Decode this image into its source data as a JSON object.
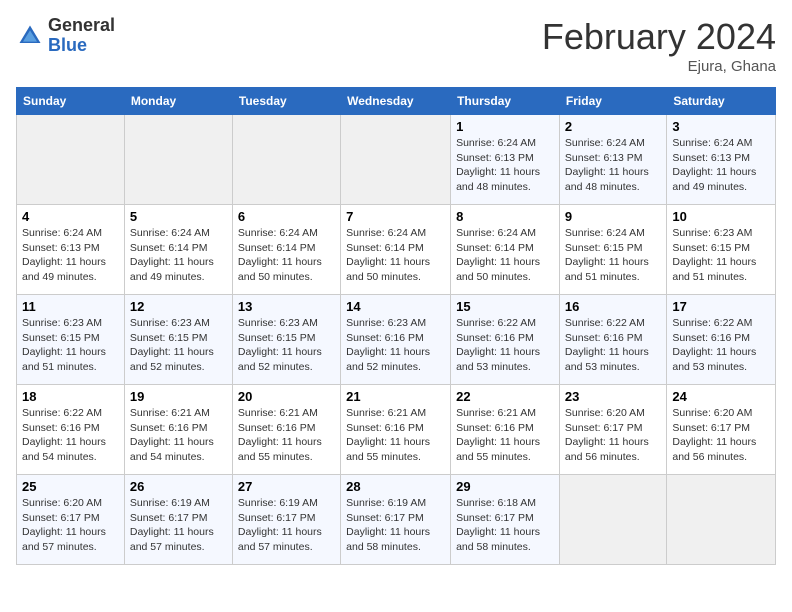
{
  "header": {
    "logo_general": "General",
    "logo_blue": "Blue",
    "month_title": "February 2024",
    "location": "Ejura, Ghana"
  },
  "days_of_week": [
    "Sunday",
    "Monday",
    "Tuesday",
    "Wednesday",
    "Thursday",
    "Friday",
    "Saturday"
  ],
  "weeks": [
    [
      {
        "day": "",
        "detail": ""
      },
      {
        "day": "",
        "detail": ""
      },
      {
        "day": "",
        "detail": ""
      },
      {
        "day": "",
        "detail": ""
      },
      {
        "day": "1",
        "detail": "Sunrise: 6:24 AM\nSunset: 6:13 PM\nDaylight: 11 hours and 48 minutes."
      },
      {
        "day": "2",
        "detail": "Sunrise: 6:24 AM\nSunset: 6:13 PM\nDaylight: 11 hours and 48 minutes."
      },
      {
        "day": "3",
        "detail": "Sunrise: 6:24 AM\nSunset: 6:13 PM\nDaylight: 11 hours and 49 minutes."
      }
    ],
    [
      {
        "day": "4",
        "detail": "Sunrise: 6:24 AM\nSunset: 6:13 PM\nDaylight: 11 hours and 49 minutes."
      },
      {
        "day": "5",
        "detail": "Sunrise: 6:24 AM\nSunset: 6:14 PM\nDaylight: 11 hours and 49 minutes."
      },
      {
        "day": "6",
        "detail": "Sunrise: 6:24 AM\nSunset: 6:14 PM\nDaylight: 11 hours and 50 minutes."
      },
      {
        "day": "7",
        "detail": "Sunrise: 6:24 AM\nSunset: 6:14 PM\nDaylight: 11 hours and 50 minutes."
      },
      {
        "day": "8",
        "detail": "Sunrise: 6:24 AM\nSunset: 6:14 PM\nDaylight: 11 hours and 50 minutes."
      },
      {
        "day": "9",
        "detail": "Sunrise: 6:24 AM\nSunset: 6:15 PM\nDaylight: 11 hours and 51 minutes."
      },
      {
        "day": "10",
        "detail": "Sunrise: 6:23 AM\nSunset: 6:15 PM\nDaylight: 11 hours and 51 minutes."
      }
    ],
    [
      {
        "day": "11",
        "detail": "Sunrise: 6:23 AM\nSunset: 6:15 PM\nDaylight: 11 hours and 51 minutes."
      },
      {
        "day": "12",
        "detail": "Sunrise: 6:23 AM\nSunset: 6:15 PM\nDaylight: 11 hours and 52 minutes."
      },
      {
        "day": "13",
        "detail": "Sunrise: 6:23 AM\nSunset: 6:15 PM\nDaylight: 11 hours and 52 minutes."
      },
      {
        "day": "14",
        "detail": "Sunrise: 6:23 AM\nSunset: 6:16 PM\nDaylight: 11 hours and 52 minutes."
      },
      {
        "day": "15",
        "detail": "Sunrise: 6:22 AM\nSunset: 6:16 PM\nDaylight: 11 hours and 53 minutes."
      },
      {
        "day": "16",
        "detail": "Sunrise: 6:22 AM\nSunset: 6:16 PM\nDaylight: 11 hours and 53 minutes."
      },
      {
        "day": "17",
        "detail": "Sunrise: 6:22 AM\nSunset: 6:16 PM\nDaylight: 11 hours and 53 minutes."
      }
    ],
    [
      {
        "day": "18",
        "detail": "Sunrise: 6:22 AM\nSunset: 6:16 PM\nDaylight: 11 hours and 54 minutes."
      },
      {
        "day": "19",
        "detail": "Sunrise: 6:21 AM\nSunset: 6:16 PM\nDaylight: 11 hours and 54 minutes."
      },
      {
        "day": "20",
        "detail": "Sunrise: 6:21 AM\nSunset: 6:16 PM\nDaylight: 11 hours and 55 minutes."
      },
      {
        "day": "21",
        "detail": "Sunrise: 6:21 AM\nSunset: 6:16 PM\nDaylight: 11 hours and 55 minutes."
      },
      {
        "day": "22",
        "detail": "Sunrise: 6:21 AM\nSunset: 6:16 PM\nDaylight: 11 hours and 55 minutes."
      },
      {
        "day": "23",
        "detail": "Sunrise: 6:20 AM\nSunset: 6:17 PM\nDaylight: 11 hours and 56 minutes."
      },
      {
        "day": "24",
        "detail": "Sunrise: 6:20 AM\nSunset: 6:17 PM\nDaylight: 11 hours and 56 minutes."
      }
    ],
    [
      {
        "day": "25",
        "detail": "Sunrise: 6:20 AM\nSunset: 6:17 PM\nDaylight: 11 hours and 57 minutes."
      },
      {
        "day": "26",
        "detail": "Sunrise: 6:19 AM\nSunset: 6:17 PM\nDaylight: 11 hours and 57 minutes."
      },
      {
        "day": "27",
        "detail": "Sunrise: 6:19 AM\nSunset: 6:17 PM\nDaylight: 11 hours and 57 minutes."
      },
      {
        "day": "28",
        "detail": "Sunrise: 6:19 AM\nSunset: 6:17 PM\nDaylight: 11 hours and 58 minutes."
      },
      {
        "day": "29",
        "detail": "Sunrise: 6:18 AM\nSunset: 6:17 PM\nDaylight: 11 hours and 58 minutes."
      },
      {
        "day": "",
        "detail": ""
      },
      {
        "day": "",
        "detail": ""
      }
    ]
  ]
}
